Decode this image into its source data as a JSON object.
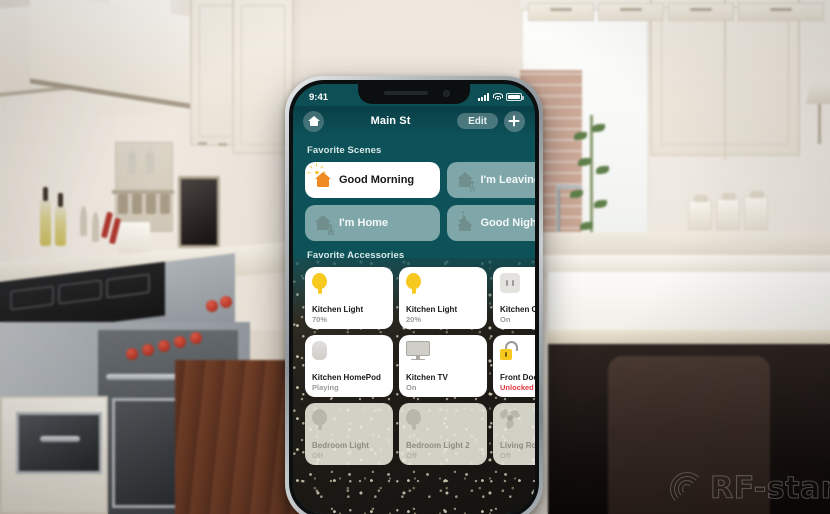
{
  "scene_photo": {
    "description": "Modern cream kitchen interior with stainless range and bright window",
    "watermark": "RF-star"
  },
  "phone": {
    "status_bar": {
      "time": "9:41",
      "icons": [
        "cellular-signal-icon",
        "wifi-icon",
        "battery-icon"
      ]
    },
    "nav": {
      "home_icon": "home-icon",
      "title": "Main St",
      "edit_label": "Edit",
      "add_icon": "plus-icon"
    },
    "sections": [
      {
        "title": "Favorite Scenes",
        "scenes": [
          {
            "label": "Good Morning",
            "icon": "sunrise-house-icon",
            "active": true
          },
          {
            "label": "I'm Leaving",
            "icon": "house-person-icon",
            "active": false
          },
          {
            "label": "I'm Home",
            "icon": "house-person-icon",
            "active": false
          },
          {
            "label": "Good Night",
            "icon": "moon-house-icon",
            "active": false
          }
        ]
      },
      {
        "title": "Favorite Accessories",
        "accessories": [
          {
            "name": "Kitchen Light",
            "state": "70%",
            "icon": "lightbulb-icon",
            "on": true,
            "alert": false
          },
          {
            "name": "Kitchen Light",
            "state": "20%",
            "icon": "lightbulb-icon",
            "on": true,
            "alert": false
          },
          {
            "name": "Kitchen Outlet",
            "state": "On",
            "icon": "outlet-icon",
            "on": true,
            "alert": false
          },
          {
            "name": "Kitchen HomePod",
            "state": "Playing",
            "icon": "homepod-icon",
            "on": true,
            "alert": false
          },
          {
            "name": "Kitchen TV",
            "state": "On",
            "icon": "television-icon",
            "on": true,
            "alert": false
          },
          {
            "name": "Front Door",
            "state": "Unlocked",
            "icon": "unlocked-padlock-icon",
            "on": true,
            "alert": true
          },
          {
            "name": "Bedroom Light",
            "state": "Off",
            "icon": "lightbulb-icon",
            "on": false,
            "alert": false
          },
          {
            "name": "Bedroom Light 2",
            "state": "Off",
            "icon": "lightbulb-icon",
            "on": false,
            "alert": false
          },
          {
            "name": "Living Room Fan",
            "state": "Off",
            "icon": "fan-icon",
            "on": false,
            "alert": false
          }
        ]
      }
    ]
  },
  "colors": {
    "app_teal": "#0d5159",
    "nav_teal_dark": "#0a3f46",
    "bulb_yellow": "#f7c91f",
    "alert_red": "#e2373f",
    "card_white": "#ffffff"
  }
}
